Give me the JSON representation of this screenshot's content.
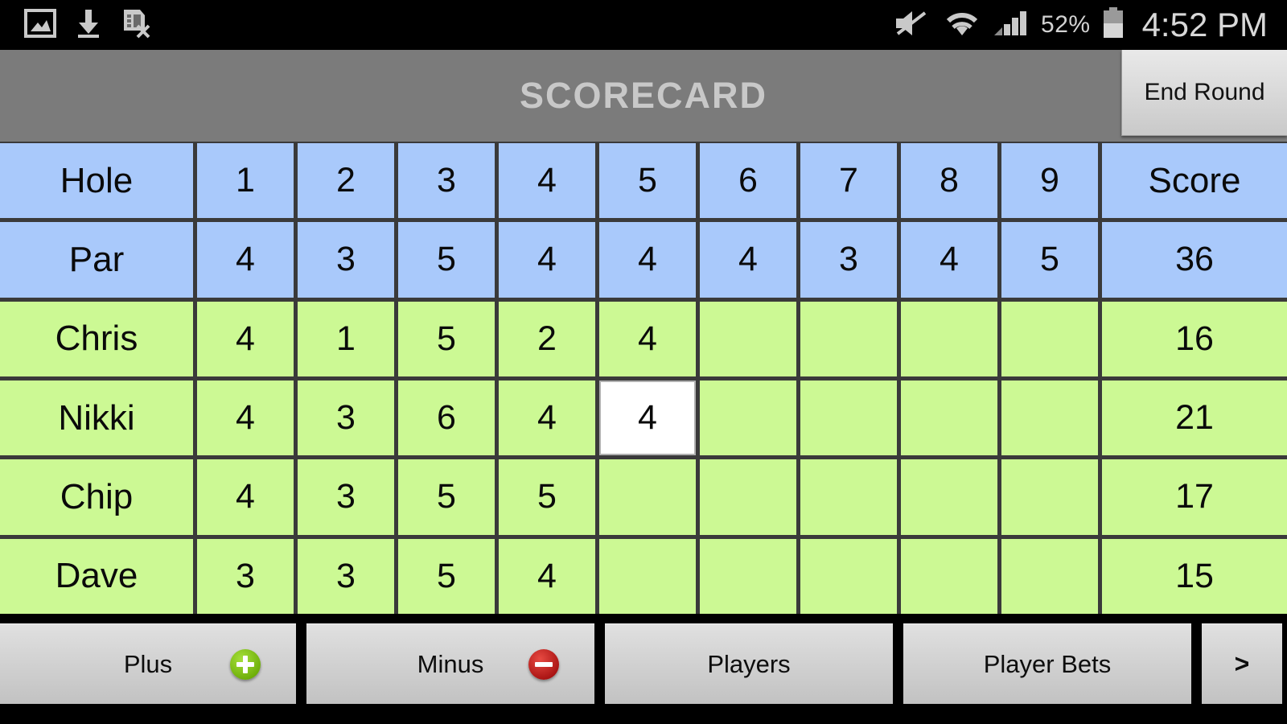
{
  "statusbar": {
    "left_icons": [
      "image-icon",
      "download-icon",
      "document-cancel-icon"
    ],
    "right_icons": [
      "mute-icon",
      "wifi-icon",
      "signal-icon",
      "battery-icon"
    ],
    "battery_percent": "52%",
    "clock": "4:52 PM"
  },
  "titlebar": {
    "title": "SCORECARD",
    "end_round_label": "End Round"
  },
  "scorecard": {
    "row_header_labels": [
      "Hole",
      "Par"
    ],
    "hole_labels": [
      "1",
      "2",
      "3",
      "4",
      "5",
      "6",
      "7",
      "8",
      "9"
    ],
    "score_label": "Score",
    "par_values": [
      "4",
      "3",
      "5",
      "4",
      "4",
      "4",
      "3",
      "4",
      "5"
    ],
    "par_total": "36",
    "players": [
      {
        "name": "Chris",
        "scores": [
          "4",
          "1",
          "5",
          "2",
          "4",
          "",
          "",
          "",
          ""
        ],
        "total": "16"
      },
      {
        "name": "Nikki",
        "scores": [
          "4",
          "3",
          "6",
          "4",
          "4",
          "",
          "",
          "",
          ""
        ],
        "total": "21"
      },
      {
        "name": "Chip",
        "scores": [
          "4",
          "3",
          "5",
          "5",
          "",
          "",
          "",
          "",
          ""
        ],
        "total": "17"
      },
      {
        "name": "Dave",
        "scores": [
          "3",
          "3",
          "5",
          "4",
          "",
          "",
          "",
          "",
          ""
        ],
        "total": "15"
      }
    ],
    "selected_cell": {
      "player_index": 1,
      "hole_index": 4,
      "value": "4"
    },
    "colors": {
      "header_row": "#a9c9fb",
      "player_row": "#ccf994",
      "selected_cell": "#ffffff",
      "grid_line": "#3a3a3a"
    }
  },
  "toolbar": {
    "buttons": [
      {
        "label": "Plus",
        "icon": "plus-circle-icon"
      },
      {
        "label": "Minus",
        "icon": "minus-circle-icon"
      },
      {
        "label": "Players",
        "icon": ""
      },
      {
        "label": "Player Bets",
        "icon": ""
      },
      {
        "label": ">",
        "icon": "chevron-right-icon"
      }
    ]
  }
}
